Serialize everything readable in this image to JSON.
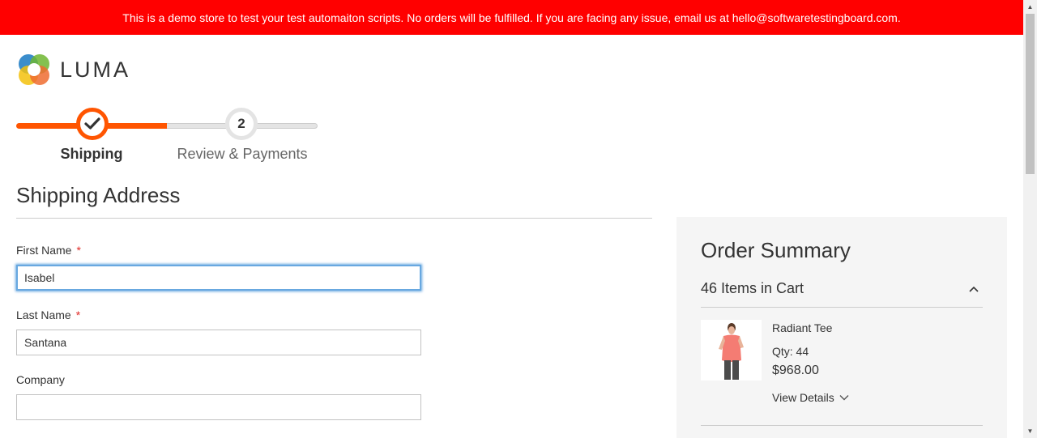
{
  "banner": {
    "text": "This is a demo store to test your test automaiton scripts. No orders will be fulfilled. If you are facing any issue, email us at hello@softwaretestingboard.com."
  },
  "logo": {
    "text": "LUMA",
    "icon": "luma-logo-icon"
  },
  "progress": {
    "step1": {
      "label": "Shipping",
      "icon": "checkmark-icon",
      "state": "active"
    },
    "step2": {
      "label": "Review & Payments",
      "number": "2",
      "state": "pending"
    }
  },
  "shipping": {
    "title": "Shipping Address",
    "fields": {
      "first_name": {
        "label": "First Name",
        "required": "*",
        "value": "Isabel"
      },
      "last_name": {
        "label": "Last Name",
        "required": "*",
        "value": "Santana"
      },
      "company": {
        "label": "Company",
        "value": ""
      }
    }
  },
  "summary": {
    "title": "Order Summary",
    "cart_count": "46 Items in Cart",
    "item": {
      "name": "Radiant Tee",
      "qty": "Qty: 44",
      "price": "$968.00",
      "details_label": "View Details"
    }
  },
  "colors": {
    "banner": "#ff0000",
    "accent": "#ff5501",
    "focus": "#68a8e0",
    "summary_bg": "#f5f5f5"
  }
}
